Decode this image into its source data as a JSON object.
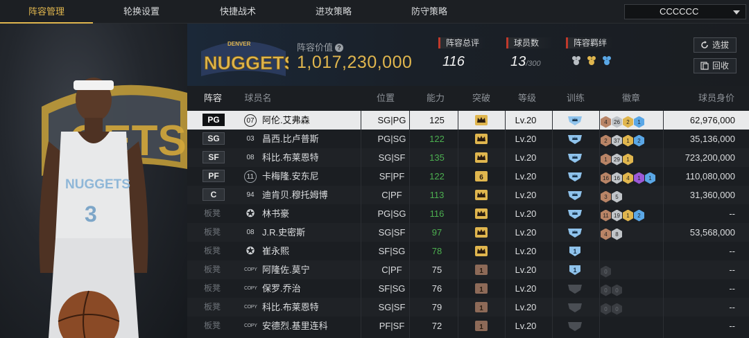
{
  "nav": {
    "tabs": [
      "阵容管理",
      "轮换设置",
      "快捷战术",
      "进攻策略",
      "防守策略"
    ],
    "active_tab": 0,
    "dropdown_value": "CCCCCC"
  },
  "team": {
    "logo_text": "NUGGETS",
    "logo_subtext": "DENVER",
    "lineup_value_label": "阵容价值",
    "lineup_value": "1,017,230,000"
  },
  "stats": {
    "rating_label": "阵容总评",
    "rating_value": "116",
    "players_label": "球员数",
    "players_value": "13",
    "players_max": "/300",
    "bond_label": "阵容羁绊"
  },
  "buttons": {
    "select": "选拔",
    "recycle": "回收"
  },
  "columns": {
    "lineup": "阵容",
    "player": "球员名",
    "position": "位置",
    "ability": "能力",
    "breakthrough": "突破",
    "level": "等级",
    "training": "训练",
    "badges": "徽章",
    "value": "球员身价"
  },
  "colors": {
    "accent_gold": "#e0b64e",
    "ability_green": "#4caf50",
    "stat_red": "#c0392b"
  },
  "rows": [
    {
      "slot": "PG",
      "bench": false,
      "jersey": "07",
      "jersey_style": "circle",
      "name": "阿伦.艾弗森",
      "position": "SG|PG",
      "ability": "125",
      "ability_green": false,
      "crown": "gold",
      "level": "Lv.20",
      "train": "blue",
      "badges": [
        [
          "bronze",
          "4"
        ],
        [
          "silver",
          "26"
        ],
        [
          "gold",
          "2"
        ],
        [
          "blue",
          "1"
        ]
      ],
      "price": "62,976,000",
      "selected": true
    },
    {
      "slot": "SG",
      "bench": false,
      "jersey": "03",
      "jersey_style": "plain",
      "name": "昌西.比卢普斯",
      "position": "PG|SG",
      "ability": "122",
      "ability_green": true,
      "crown": "gold",
      "level": "Lv.20",
      "train": "blue",
      "badges": [
        [
          "bronze",
          "2"
        ],
        [
          "silver",
          "37"
        ],
        [
          "gold",
          "1"
        ],
        [
          "blue",
          "2"
        ]
      ],
      "price": "35,136,000",
      "selected": false
    },
    {
      "slot": "SF",
      "bench": false,
      "jersey": "08",
      "jersey_style": "plain",
      "name": "科比.布莱恩特",
      "position": "SG|SF",
      "ability": "135",
      "ability_green": true,
      "crown": "gold",
      "level": "Lv.20",
      "train": "blue",
      "badges": [
        [
          "bronze",
          "1"
        ],
        [
          "silver",
          "29"
        ],
        [
          "gold",
          "1"
        ]
      ],
      "price": "723,200,000",
      "selected": false
    },
    {
      "slot": "PF",
      "bench": false,
      "jersey": "11",
      "jersey_style": "circle",
      "name": "卡梅隆.安东尼",
      "position": "SF|PF",
      "ability": "122",
      "ability_green": true,
      "crown": "gold6",
      "level": "Lv.20",
      "train": "blue",
      "badges": [
        [
          "bronze",
          "16"
        ],
        [
          "silver",
          "16"
        ],
        [
          "gold",
          "4"
        ],
        [
          "purple",
          "1"
        ],
        [
          "blue",
          "1"
        ]
      ],
      "price": "110,080,000",
      "selected": false
    },
    {
      "slot": "C",
      "bench": false,
      "jersey": "94",
      "jersey_style": "plain",
      "name": "迪肯贝.穆托姆博",
      "position": "C|PF",
      "ability": "113",
      "ability_green": true,
      "crown": "gold",
      "level": "Lv.20",
      "train": "blue",
      "badges": [
        [
          "bronze",
          "3"
        ],
        [
          "silver",
          "5"
        ]
      ],
      "price": "31,360,000",
      "selected": false
    },
    {
      "slot": "板凳",
      "bench": true,
      "jersey": "",
      "jersey_style": "star",
      "name": "林书豪",
      "position": "PG|SG",
      "ability": "116",
      "ability_green": true,
      "crown": "gold",
      "level": "Lv.20",
      "train": "blue",
      "badges": [
        [
          "bronze",
          "11"
        ],
        [
          "silver",
          "19"
        ],
        [
          "gold",
          "1"
        ],
        [
          "blue",
          "2"
        ]
      ],
      "price": "--",
      "selected": false
    },
    {
      "slot": "板凳",
      "bench": true,
      "jersey": "08",
      "jersey_style": "plain",
      "name": "J.R.史密斯",
      "position": "SG|SF",
      "ability": "97",
      "ability_green": true,
      "crown": "gold",
      "level": "Lv.20",
      "train": "blue",
      "badges": [
        [
          "bronze",
          "4"
        ],
        [
          "silver",
          "8"
        ]
      ],
      "price": "53,568,000",
      "selected": false
    },
    {
      "slot": "板凳",
      "bench": true,
      "jersey": "",
      "jersey_style": "star",
      "name": "崔永熙",
      "position": "SF|SG",
      "ability": "78",
      "ability_green": true,
      "crown": "gold",
      "level": "Lv.20",
      "train": "blue1",
      "badges": [],
      "price": "--",
      "selected": false
    },
    {
      "slot": "板凳",
      "bench": true,
      "jersey": "COPY",
      "jersey_style": "copy",
      "name": "阿隆佐.莫宁",
      "position": "C|PF",
      "ability": "75",
      "ability_green": false,
      "crown": "bronze1",
      "level": "Lv.20",
      "train": "blue1",
      "badges": [
        [
          "empty",
          "0"
        ]
      ],
      "price": "--",
      "selected": false
    },
    {
      "slot": "板凳",
      "bench": true,
      "jersey": "COPY",
      "jersey_style": "copy",
      "name": "保罗.乔治",
      "position": "SF|SG",
      "ability": "76",
      "ability_green": false,
      "crown": "bronze1",
      "level": "Lv.20",
      "train": "grey",
      "badges": [
        [
          "empty",
          "0"
        ],
        [
          "empty",
          "0"
        ]
      ],
      "price": "--",
      "selected": false
    },
    {
      "slot": "板凳",
      "bench": true,
      "jersey": "COPY",
      "jersey_style": "copy",
      "name": "科比.布莱恩特",
      "position": "SG|SF",
      "ability": "79",
      "ability_green": false,
      "crown": "bronze1",
      "level": "Lv.20",
      "train": "grey",
      "badges": [
        [
          "empty",
          "0"
        ],
        [
          "empty",
          "0"
        ]
      ],
      "price": "--",
      "selected": false
    },
    {
      "slot": "板凳",
      "bench": true,
      "jersey": "COPY",
      "jersey_style": "copy",
      "name": "安德烈.基里连科",
      "position": "PF|SF",
      "ability": "72",
      "ability_green": false,
      "crown": "bronze1",
      "level": "Lv.20",
      "train": "grey",
      "badges": [],
      "price": "--",
      "selected": false
    }
  ]
}
